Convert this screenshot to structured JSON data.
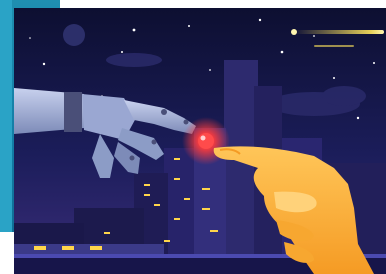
{
  "image": {
    "subject": "robot-and-human-finger-touch-illustration",
    "palette": {
      "sky_top": "#0d0f31",
      "sky_mid": "#1b1d5a",
      "sky_bottom": "#3b2d7a",
      "city_dark": "#23205c",
      "city_light": "#3a3585",
      "glow_red": "#ff3b3b",
      "human_hand": "#ffb23a",
      "human_hand_shade": "#f59b24",
      "robot_metal": "#8c9cc6",
      "robot_metal_light": "#c8d1ee",
      "robot_joint": "#4a4f78",
      "comet": "#ffe55c",
      "window_light": "#ffd54a",
      "frame_teal": "#137da6"
    }
  }
}
